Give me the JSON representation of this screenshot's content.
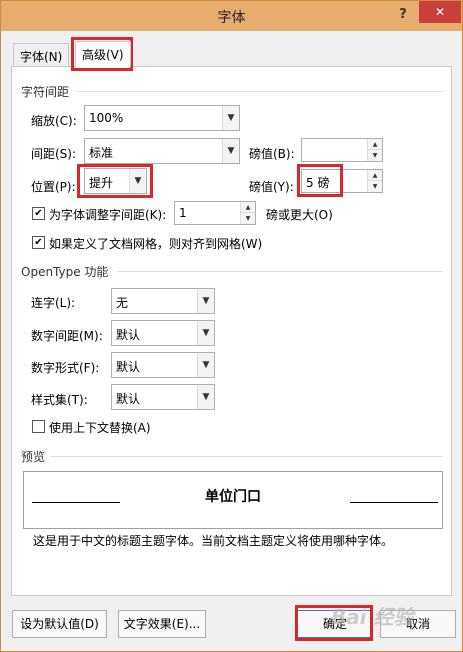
{
  "window": {
    "title": "字体",
    "help": "?",
    "close": "✕"
  },
  "tabs": [
    {
      "label": "字体(N)"
    },
    {
      "label": "高级(V)"
    }
  ],
  "spacing": {
    "section_title": "字符间距",
    "scale_label": "缩放(C):",
    "scale_value": "100%",
    "spacing_label": "间距(S):",
    "spacing_value": "标准",
    "spacing_pt_label": "磅值(B):",
    "spacing_pt_value": "",
    "position_label": "位置(P):",
    "position_value": "提升",
    "position_pt_label": "磅值(Y):",
    "position_pt_value": "5 磅",
    "kerning_label": "为字体调整字间距(K):",
    "kerning_value": "1",
    "kerning_suffix": "磅或更大(O)",
    "grid_label": "如果定义了文档网格，则对齐到网格(W)",
    "kerning_checked": true,
    "grid_checked": true
  },
  "opentype": {
    "section_title": "OpenType 功能",
    "ligature_label": "连字(L):",
    "ligature_value": "无",
    "numspacing_label": "数字间距(M):",
    "numspacing_value": "默认",
    "numform_label": "数字形式(F):",
    "numform_value": "默认",
    "styleset_label": "样式集(T):",
    "styleset_value": "默认",
    "contextual_label": "使用上下文替换(A)",
    "contextual_checked": false
  },
  "preview": {
    "section_title": "预览",
    "sample_text": "单位门口",
    "description": "这是用于中文的标题主题字体。当前文档主题定义将使用哪种字体。"
  },
  "buttons": {
    "set_default": "设为默认值(D)",
    "text_effects": "文字效果(E)...",
    "ok": "确定",
    "cancel": "取消"
  },
  "watermark": "Bai 经验",
  "colors": {
    "titlebar": "#e8ac6e",
    "highlight": "#d9272e"
  }
}
